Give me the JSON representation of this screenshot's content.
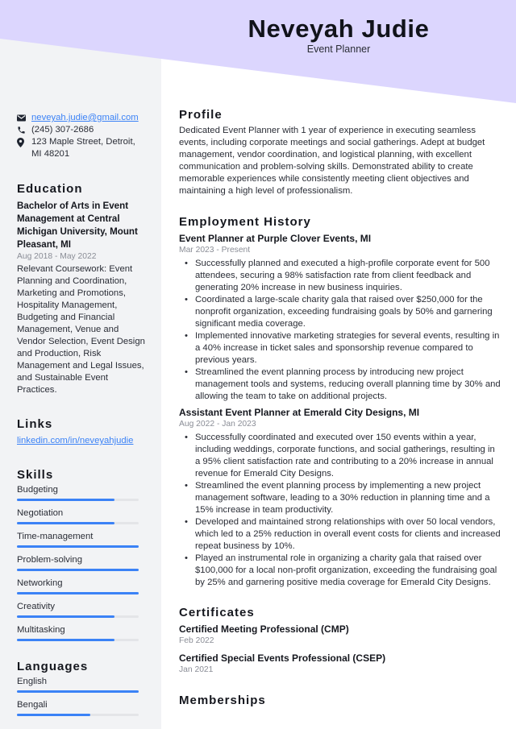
{
  "header": {
    "name": "Neveyah Judie",
    "title": "Event Planner",
    "accent_color": "#dcd6fe"
  },
  "contact": {
    "email": "neveyah.judie@gmail.com",
    "phone": "(245) 307-2686",
    "address": "123 Maple Street, Detroit, MI 48201"
  },
  "education": {
    "heading": "Education",
    "degree": "Bachelor of Arts in Event Management at Central Michigan University, Mount Pleasant, MI",
    "dates": "Aug 2018 - May 2022",
    "description": "Relevant Coursework: Event Planning and Coordination, Marketing and Promotions, Hospitality Management, Budgeting and Financial Management, Venue and Vendor Selection, Event Design and Production, Risk Management and Legal Issues, and Sustainable Event Practices."
  },
  "links": {
    "heading": "Links",
    "items": [
      {
        "label": "linkedin.com/in/neveyahjudie"
      }
    ]
  },
  "skills": {
    "heading": "Skills",
    "bar_color": "#3b82f6",
    "items": [
      {
        "label": "Budgeting",
        "level": 0.8
      },
      {
        "label": "Negotiation",
        "level": 0.8
      },
      {
        "label": "Time-management",
        "level": 1.0
      },
      {
        "label": "Problem-solving",
        "level": 1.0
      },
      {
        "label": "Networking",
        "level": 1.0
      },
      {
        "label": "Creativity",
        "level": 0.8
      },
      {
        "label": "Multitasking",
        "level": 0.8
      }
    ]
  },
  "languages": {
    "heading": "Languages",
    "items": [
      {
        "label": "English",
        "level": 1.0
      },
      {
        "label": "Bengali",
        "level": 0.6
      }
    ]
  },
  "profile": {
    "heading": "Profile",
    "text": "Dedicated Event Planner with 1 year of experience in executing seamless events, including corporate meetings and social gatherings. Adept at budget management, vendor coordination, and logistical planning, with excellent communication and problem-solving skills. Demonstrated ability to create memorable experiences while consistently meeting client objectives and maintaining a high level of professionalism."
  },
  "employment": {
    "heading": "Employment History",
    "jobs": [
      {
        "title": "Event Planner at Purple Clover Events, MI",
        "dates": "Mar 2023 - Present",
        "bullets": [
          "Successfully planned and executed a high-profile corporate event for 500 attendees, securing a 98% satisfaction rate from client feedback and generating 20% increase in new business inquiries.",
          "Coordinated a large-scale charity gala that raised over $250,000 for the nonprofit organization, exceeding fundraising goals by 50% and garnering significant media coverage.",
          "Implemented innovative marketing strategies for several events, resulting in a 40% increase in ticket sales and sponsorship revenue compared to previous years.",
          "Streamlined the event planning process by introducing new project management tools and systems, reducing overall planning time by 30% and allowing the team to take on additional projects."
        ]
      },
      {
        "title": "Assistant Event Planner at Emerald City Designs, MI",
        "dates": "Aug 2022 - Jan 2023",
        "bullets": [
          "Successfully coordinated and executed over 150 events within a year, including weddings, corporate functions, and social gatherings, resulting in a 95% client satisfaction rate and contributing to a 20% increase in annual revenue for Emerald City Designs.",
          "Streamlined the event planning process by implementing a new project management software, leading to a 30% reduction in planning time and a 15% increase in team productivity.",
          "Developed and maintained strong relationships with over 50 local vendors, which led to a 25% reduction in overall event costs for clients and increased repeat business by 10%.",
          "Played an instrumental role in organizing a charity gala that raised over $100,000 for a local non-profit organization, exceeding the fundraising goal by 25% and garnering positive media coverage for Emerald City Designs."
        ]
      }
    ]
  },
  "certificates": {
    "heading": "Certificates",
    "items": [
      {
        "title": "Certified Meeting Professional (CMP)",
        "date": "Feb 2022"
      },
      {
        "title": "Certified Special Events Professional (CSEP)",
        "date": "Jan 2021"
      }
    ]
  },
  "memberships": {
    "heading": "Memberships"
  }
}
